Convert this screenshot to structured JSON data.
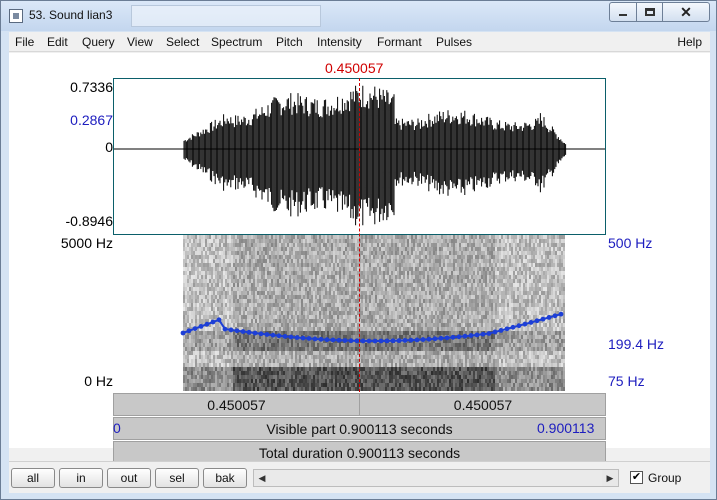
{
  "window": {
    "title": "53. Sound lian3"
  },
  "menu": {
    "items": [
      "File",
      "Edit",
      "Query",
      "View",
      "Select",
      "Spectrum",
      "Pitch",
      "Intensity",
      "Formant",
      "Pulses"
    ],
    "help": "Help"
  },
  "cursor": {
    "time": "0.450057"
  },
  "waveform": {
    "y_max": "0.7336",
    "y_cursor": "0.2867",
    "y_zero": "0",
    "y_min": "-0.8946"
  },
  "spectrogram": {
    "freq_max": "5000 Hz",
    "freq_min": "0 Hz",
    "pitch_max": "500 Hz",
    "pitch_cursor": "199.4 Hz",
    "pitch_min": "75 Hz"
  },
  "selection": {
    "left": "0.450057",
    "right": "0.450057"
  },
  "visible": {
    "start": "0",
    "end": "0.900113",
    "label": "Visible part 0.900113 seconds"
  },
  "total": {
    "label": "Total duration 0.900113 seconds"
  },
  "toolbar": {
    "all": "all",
    "in": "in",
    "out": "out",
    "sel": "sel",
    "bak": "bak",
    "group_label": "Group",
    "group_checked": "✔"
  },
  "colors": {
    "cursor": "#d00000",
    "pitch": "#1d3fd6",
    "axis_blue": "#1d1dbf"
  },
  "icons": {
    "window": "praat-window-icon",
    "scroll_left": "left-arrow-icon",
    "scroll_right": "right-arrow-icon"
  }
}
